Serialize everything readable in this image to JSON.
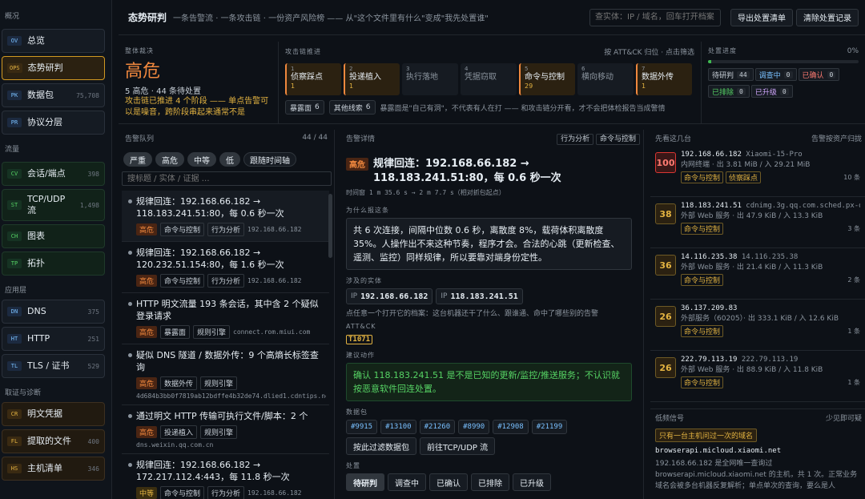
{
  "sidebar": {
    "sec_overview": "概况",
    "overview": [
      {
        "badge": "OV",
        "label": "总览",
        "count": ""
      },
      {
        "badge": "OPS",
        "label": "态势研判",
        "count": ""
      },
      {
        "badge": "PK",
        "label": "数据包",
        "count": "75,708"
      },
      {
        "badge": "PR",
        "label": "协议分层",
        "count": ""
      }
    ],
    "sec_flow": "流量",
    "flow": [
      {
        "badge": "CV",
        "label": "会话/端点",
        "count": "398"
      },
      {
        "badge": "ST",
        "label": "TCP/UDP 流",
        "count": "1,498"
      },
      {
        "badge": "CH",
        "label": "图表",
        "count": ""
      },
      {
        "badge": "TP",
        "label": "拓扑",
        "count": ""
      }
    ],
    "sec_app": "应用层",
    "app": [
      {
        "badge": "DN",
        "label": "DNS",
        "count": "375"
      },
      {
        "badge": "HT",
        "label": "HTTP",
        "count": "251"
      },
      {
        "badge": "TL",
        "label": "TLS / 证书",
        "count": "529"
      }
    ],
    "sec_forensic": "取证与诊断",
    "forensic": [
      {
        "badge": "CR",
        "label": "明文凭据",
        "count": ""
      },
      {
        "badge": "FL",
        "label": "提取的文件",
        "count": "400"
      },
      {
        "badge": "HS",
        "label": "主机清单",
        "count": "346"
      }
    ]
  },
  "header": {
    "title": "态势研判",
    "subtitle": "一条告警流 · 一条攻击链 · 一份资产风险榜 —— 从\"这个文件里有什么\"变成\"我先处置谁\"",
    "search_placeholder": "查实体：IP / 域名，回车打开档案",
    "export_btn": "导出处置清单",
    "clear_btn": "清除处置记录"
  },
  "overall": {
    "label": "整体裁决",
    "level": "高危",
    "summary": "5 高危 · 44 条待处置",
    "warning": "攻击链已推进 4 个阶段 —— 单点告警可以是噪音，跨阶段串起来通常不是"
  },
  "chain": {
    "label": "攻击链推进",
    "hint": "按 ATT&CK 归位 · 点击筛选",
    "steps": [
      {
        "n": "1",
        "label": "侦察踩点",
        "count": "1",
        "on": true
      },
      {
        "n": "2",
        "label": "投递植入",
        "count": "1",
        "on": true
      },
      {
        "n": "3",
        "label": "执行落地",
        "count": "",
        "on": false
      },
      {
        "n": "4",
        "label": "凭据窃取",
        "count": "",
        "on": false
      },
      {
        "n": "5",
        "label": "命令与控制",
        "count": "29",
        "on": true
      },
      {
        "n": "6",
        "label": "横向移动",
        "count": "",
        "on": false
      },
      {
        "n": "7",
        "label": "数据外传",
        "count": "1",
        "on": true
      }
    ],
    "tag1_label": "暴露面",
    "tag1_count": "6",
    "tag2_label": "其他线索",
    "tag2_count": "6",
    "note": "暴露面是\"自己有洞\"，不代表有人在打 —— 和攻击链分开看，才不会把体检报告当成警情"
  },
  "progress": {
    "label": "处置进度",
    "pct": "0%",
    "fraction": 0.02,
    "stats": [
      {
        "label": "待研判",
        "count": "44"
      },
      {
        "label": "调查中",
        "count": "0"
      },
      {
        "label": "已确认",
        "count": "0"
      },
      {
        "label": "已排除",
        "count": "0"
      },
      {
        "label": "已升级",
        "count": "0"
      }
    ]
  },
  "queue": {
    "label": "告警队列",
    "count": "44 / 44",
    "filters": [
      "严重",
      "高危",
      "中等",
      "低",
      "跟随时间轴"
    ],
    "search_placeholder": "搜标题 / 实体 / 证据 …",
    "items": [
      {
        "title": "规律回连：192.168.66.182 → 118.183.241.51:80，每 0.6 秒一次",
        "sev": "高危",
        "t1": "命令与控制",
        "t2": "行为分析",
        "mono": "192.168.66.182"
      },
      {
        "title": "规律回连：192.168.66.182 → 120.232.51.154:80，每 1.6 秒一次",
        "sev": "高危",
        "t1": "命令与控制",
        "t2": "行为分析",
        "mono": "192.168.66.182"
      },
      {
        "title": "HTTP 明文流量 193 条会话，其中含 2 个疑似登录请求",
        "sev": "高危",
        "t1": "暴露面",
        "t2": "规则引擎",
        "mono": "connect.rom.miui.com"
      },
      {
        "title": "疑似 DNS 隧道 / 数据外传：9 个高熵长标签查询",
        "sev": "高危",
        "t1": "数据外传",
        "t2": "规则引擎",
        "mono": "4d684b3bb0f7819ab12bdffe4b32de74.dlied1.cdntips.net"
      },
      {
        "title": "通过明文 HTTP 传输可执行文件/脚本：2 个",
        "sev": "高危",
        "t1": "投递植入",
        "t2": "规则引擎",
        "mono": "dns.weixin.qq.com.cn"
      },
      {
        "title": "规律回连：192.168.66.182 → 172.217.112.4:443，每 11.8 秒一次",
        "sev": "中等",
        "t1": "命令与控制",
        "t2": "行为分析",
        "mono": "192.168.66.182"
      }
    ]
  },
  "detail": {
    "label": "告警详情",
    "tag1": "行为分析",
    "tag2": "命令与控制",
    "sev": "高危",
    "title": "规律回连：192.168.66.182 → 118.183.241.51:80，每 0.6 秒一次",
    "time": "时间窗 1 m 35.6 s → 2 m 7.7 s（相对抓包起点）",
    "why_label": "为什么报这条",
    "why": "共 6 次连接，间隔中位数 0.6 秒，离散度 8%，载荷体积离散度 35%。人操作出不来这种节奏，程序才会。合法的心跳（更新检查、遥测、监控）同样规律，所以要靠对端身份定性。",
    "entity_label": "涉及的实体",
    "entities": [
      {
        "k": "IP",
        "v": "192.168.66.182"
      },
      {
        "k": "IP",
        "v": "118.183.241.51"
      }
    ],
    "entity_hint": "点任意一个打开它的档案：这台机器还干了什么、跟谁通、命中了哪些别的告警",
    "attck_label": "ATT&CK",
    "attck": "T1071",
    "action_label": "建议动作",
    "action": "确认 118.183.241.51 是不是已知的更新/监控/推送服务；不认识就按恶意软件回连处置。",
    "pkt_label": "数据包",
    "pkts": [
      "#9915",
      "#13100",
      "#21260",
      "#8990",
      "#12908",
      "#21199"
    ],
    "pkt_btn1": "按此过滤数据包",
    "pkt_btn2": "前往TCP/UDP 流",
    "disp_label": "处置",
    "disp": [
      "待研判",
      "调查中",
      "已确认",
      "已排除",
      "已升级"
    ]
  },
  "hosts": {
    "label": "先看这几台",
    "hint": "告警按资产归拢",
    "items": [
      {
        "score": "100",
        "ip": "192.168.66.182",
        "name": "Xiaomi-15-Pro",
        "sub": "内网终端 · 出 3.81 MiB / 入 29.21 MiB",
        "tags": [
          "命令与控制",
          "侦察踩点"
        ],
        "n": "10 条"
      },
      {
        "score": "38",
        "ip": "118.183.241.51",
        "name": "cdnimg.3g.qq.com.sched.px-dk.tdnsv6.com",
        "sub": "外部 Web 服务 · 出 47.9 KiB / 入 13.3 KiB",
        "tags": [
          "命令与控制"
        ],
        "n": "3 条"
      },
      {
        "score": "36",
        "ip": "14.116.235.38",
        "name": "14.116.235.38",
        "sub": "外部 Web 服务 · 出 21.4 KiB / 入 11.3 KiB",
        "tags": [
          "命令与控制"
        ],
        "n": "2 条"
      },
      {
        "score": "26",
        "ip": "36.137.209.83",
        "name": "",
        "sub": "外部服务（60205）· 出 333.1 KiB / 入 12.6 KiB",
        "tags": [
          "命令与控制"
        ],
        "n": "1 条"
      },
      {
        "score": "26",
        "ip": "222.79.113.19",
        "name": "222.79.113.19",
        "sub": "外部 Web 服务 · 出 88.9 KiB / 入 11.8 KiB",
        "tags": [
          "命令与控制"
        ],
        "n": "1 条"
      }
    ]
  },
  "lowsignal": {
    "label": "低频信号",
    "hint": "少见即可疑",
    "tag": "只有一台主机问过一次的域名",
    "domain": "browserapi.micloud.xiaomi.net",
    "text": "192.168.66.182 是全网唯一查询过 browserapi.micloud.xiaomi.net 的主机，共 1 次。正常业务域名会被多台机器反复解析；单点单次的查询，要么是人"
  }
}
